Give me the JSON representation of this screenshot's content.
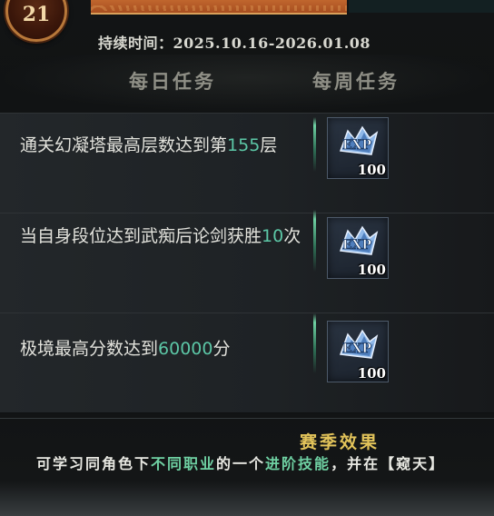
{
  "header": {
    "level": "21",
    "duration": "持续时间：2025.10.16-2026.01.08"
  },
  "tabs": [
    {
      "label": "每日任务"
    },
    {
      "label": "每周任务"
    }
  ],
  "tasks": [
    {
      "text_before": "通关幻凝塔最高层数达到第",
      "highlight": "155",
      "text_after": "层",
      "reward": {
        "icon": "exp-icon",
        "count": "100"
      }
    },
    {
      "text_before": "当自身段位达到武痴后论剑获胜",
      "highlight": "10",
      "text_after": "次",
      "reward": {
        "icon": "exp-icon",
        "count": "100"
      }
    },
    {
      "text_before": "极境最高分数达到",
      "highlight": "60000",
      "text_after": "分",
      "reward": {
        "icon": "exp-icon",
        "count": "100"
      }
    }
  ],
  "season": {
    "title": "赛季效果",
    "desc_1": "可学习同角色下",
    "desc_hl_1": "不同职业",
    "desc_2": "的一个",
    "desc_hl_2": "进阶技能",
    "desc_3": "，并在【窥天】"
  },
  "colors": {
    "highlight": "#5cc7a6",
    "season_title": "#e2c35a",
    "banner": "#c0662e"
  }
}
